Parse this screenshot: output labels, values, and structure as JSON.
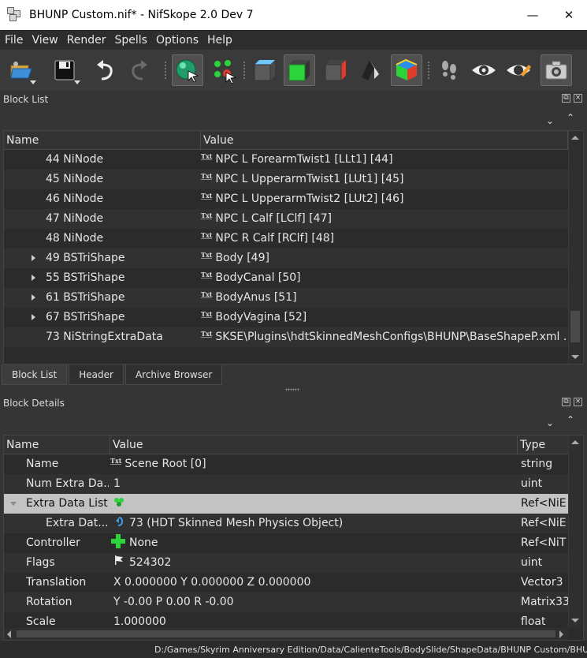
{
  "window": {
    "title": "BHUNP Custom.nif* - NifSkope 2.0 Dev 7",
    "minimize": "—",
    "close": "✕"
  },
  "menu": [
    "File",
    "Edit",
    "View",
    "Render",
    "Spells",
    "Options",
    "Help"
  ],
  "menu_display": [
    "File",
    "View",
    "Render",
    "Spells",
    "Options",
    "Help"
  ],
  "toolbar": {
    "icons": [
      "load-icon",
      "save-icon",
      "undo-icon",
      "redo-icon",
      "select-object-icon",
      "select-vertex-icon",
      "shading-flat-icon",
      "shading-solid-icon",
      "shading-textured-icon",
      "shading-wire-icon",
      "shading-color-icon",
      "footprint-icon",
      "visibility-icon",
      "visibility-highlight-icon",
      "screenshot-icon"
    ]
  },
  "block_list": {
    "title": "Block List",
    "columns": [
      "Name",
      "Value"
    ],
    "rows": [
      {
        "name": "44 NiNode",
        "value": "NPC L ForearmTwist1 [LLt1] [44]",
        "expandable": false
      },
      {
        "name": "45 NiNode",
        "value": "NPC L UpperarmTwist1 [LUt1] [45]",
        "expandable": false
      },
      {
        "name": "46 NiNode",
        "value": "NPC L UpperarmTwist2 [LUt2] [46]",
        "expandable": false
      },
      {
        "name": "47 NiNode",
        "value": "NPC L Calf [LClf] [47]",
        "expandable": false
      },
      {
        "name": "48 NiNode",
        "value": "NPC R Calf [RClf] [48]",
        "expandable": false
      },
      {
        "name": "49 BSTriShape",
        "value": "Body [49]",
        "expandable": true
      },
      {
        "name": "55 BSTriShape",
        "value": "BodyCanal [50]",
        "expandable": true
      },
      {
        "name": "61 BSTriShape",
        "value": "BodyAnus [51]",
        "expandable": true
      },
      {
        "name": "67 BSTriShape",
        "value": "BodyVagina [52]",
        "expandable": true
      },
      {
        "name": "73 NiStringExtraData",
        "value": "SKSE\\Plugins\\hdtSkinnedMeshConfigs\\BHUNP\\BaseShapeP.xml ...",
        "expandable": false
      }
    ]
  },
  "tabs": [
    "Block List",
    "Header",
    "Archive Browser"
  ],
  "block_details": {
    "title": "Block Details",
    "columns": [
      "Name",
      "Value",
      "Type"
    ],
    "rows": [
      {
        "name": "Name",
        "value": "Scene Root [0]",
        "type": "string",
        "icon": "txt-icon"
      },
      {
        "name": "Num Extra Da...",
        "value": "1",
        "type": "uint",
        "icon": ""
      },
      {
        "name": "Extra Data List",
        "value": "",
        "type": "Ref<NiE",
        "icon": "array-icon",
        "selected": true
      },
      {
        "name": "Extra Dat...",
        "value": "73 (HDT Skinned Mesh Physics Object)",
        "type": "Ref<NiE",
        "icon": "link-icon"
      },
      {
        "name": "Controller",
        "value": "None",
        "type": "Ref<NiT",
        "icon": "plus-icon"
      },
      {
        "name": "Flags",
        "value": "524302",
        "type": "uint",
        "icon": "flag-icon"
      },
      {
        "name": "Translation",
        "value": "X 0.000000 Y 0.000000 Z 0.000000",
        "type": "Vector3",
        "icon": ""
      },
      {
        "name": "Rotation",
        "value": "Y -0.00 P 0.00 R -0.00",
        "type": "Matrix33",
        "icon": ""
      },
      {
        "name": "Scale",
        "value": "1.000000",
        "type": "float",
        "icon": ""
      }
    ]
  },
  "status_bar": {
    "path": "D:/Games/Skyrim Anniversary Edition/Data/CalienteTools/BodySlide/ShapeData/BHUNP Custom/BHUN"
  },
  "colors": {
    "background": "#353535",
    "panel": "#2b2b2b",
    "selected_row": "#c3c3c3",
    "accent_green": "#2bd43a"
  }
}
